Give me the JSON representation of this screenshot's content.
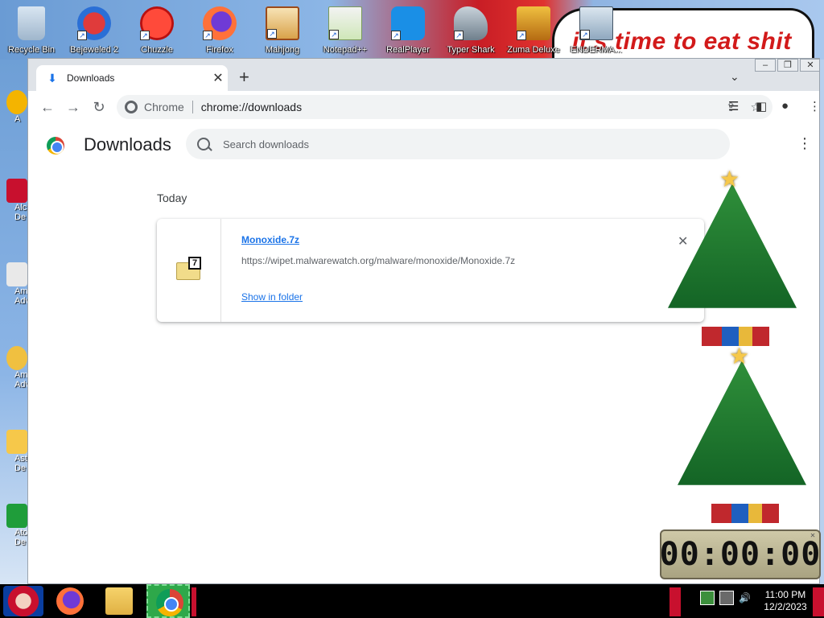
{
  "desktop": {
    "icons": [
      {
        "label": "Recycle Bin"
      },
      {
        "label": "Bejeweled 2"
      },
      {
        "label": "Chuzzle"
      },
      {
        "label": "Firefox"
      },
      {
        "label": "Mahjong"
      },
      {
        "label": "Notepad++"
      },
      {
        "label": "RealPlayer"
      },
      {
        "label": "Typer Shark"
      },
      {
        "label": "Zuma Deluxe"
      },
      {
        "label": "ENDERMA..."
      }
    ],
    "left_icons": [
      {
        "label": "A"
      },
      {
        "label": "Alc De"
      },
      {
        "label": "Am Adv"
      },
      {
        "label": "Am Adv"
      },
      {
        "label": "Ast De"
      },
      {
        "label": "Ato De"
      }
    ],
    "speech_text": "it's time to eat shit"
  },
  "window": {
    "caption": {
      "minimize": "–",
      "restore": "❐",
      "close": "✕"
    },
    "tab": {
      "title": "Downloads",
      "close": "✕"
    },
    "new_tab": "+",
    "tab_menu": "⌄",
    "toolbar": {
      "back": "←",
      "forward": "→",
      "reload": "↻",
      "site_label": "Chrome",
      "url": "chrome://downloads"
    }
  },
  "downloads": {
    "title": "Downloads",
    "search_placeholder": "Search downloads",
    "more": "⋮",
    "date_header": "Today",
    "items": [
      {
        "filename": "Monoxide.7z",
        "url": "https://wipet.malwarewatch.org/malware/monoxide/Monoxide.7z",
        "action": "Show in folder",
        "remove": "✕",
        "icon_text": "7"
      }
    ]
  },
  "timer": {
    "display": "00:00:00"
  },
  "taskbar": {
    "time": "11:00 PM",
    "date": "12/2/2023"
  },
  "colors": {
    "accent": "#1a73e8",
    "taskbar": "#000000",
    "tab_strip": "#dfe3e8"
  }
}
